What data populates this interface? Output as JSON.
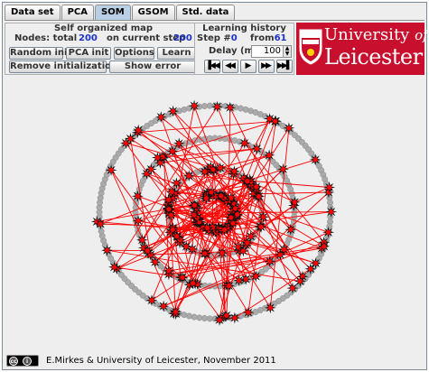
{
  "tabs": [
    {
      "label": "Data set",
      "active": false
    },
    {
      "label": "PCA",
      "active": false
    },
    {
      "label": "SOM",
      "active": true
    },
    {
      "label": "GSOM",
      "active": false
    },
    {
      "label": "Std. data",
      "active": false
    }
  ],
  "som_panel": {
    "title": "Self organized map",
    "nodes_total_label": "Nodes: total",
    "nodes_total": "200",
    "current_step_label": "on current step",
    "current_step": "200",
    "buttons": {
      "random_init": "Random init",
      "pca_init": "PCA init",
      "options": "Options",
      "learn": "Learn",
      "remove_init": "Remove initialization",
      "show_error": "Show error"
    }
  },
  "history_panel": {
    "title": "Learning history",
    "step_label": "Step #",
    "step": "0",
    "from_label": "from",
    "from": "61",
    "delay_label": "Delay (ms)",
    "delay_value": "100"
  },
  "logo": {
    "line1_a": "University",
    "line1_b": "of",
    "line2": "Leicester"
  },
  "footer": {
    "credit": "E.Mirkes & University of Leicester, November 2011"
  },
  "colors": {
    "accent_blue": "#1c31c6",
    "brand_red": "#c8102e",
    "edge_red": "#ff0000"
  }
}
